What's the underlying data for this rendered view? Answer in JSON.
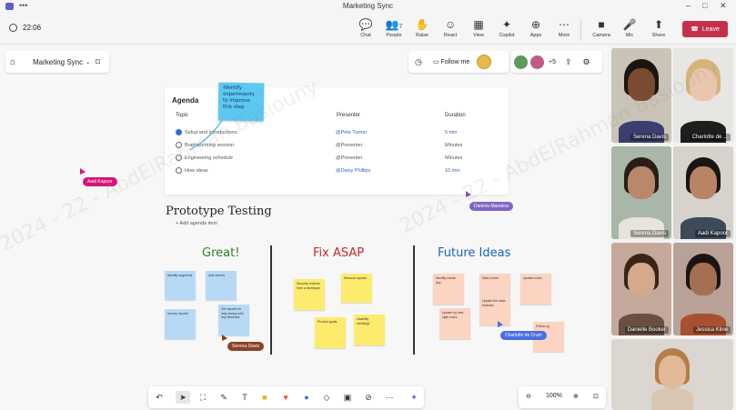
{
  "window": {
    "title": "Marketing Sync",
    "dots": "•••"
  },
  "toolbar": {
    "time": "22:06",
    "buttons": [
      {
        "label": "Chat",
        "icon": "chat-icon",
        "glyph": "💬"
      },
      {
        "label": "People",
        "icon": "people-icon",
        "glyph": "👥",
        "count": "7"
      },
      {
        "label": "Raise",
        "icon": "raise-hand-icon",
        "glyph": "✋"
      },
      {
        "label": "React",
        "icon": "react-icon",
        "glyph": "☺"
      },
      {
        "label": "View",
        "icon": "view-icon",
        "glyph": "▦"
      },
      {
        "label": "Copilot",
        "icon": "copilot-icon",
        "glyph": "✦"
      },
      {
        "label": "Apps",
        "icon": "apps-icon",
        "glyph": "⊕"
      },
      {
        "label": "More",
        "icon": "more-icon",
        "glyph": "⋯"
      },
      {
        "label": "Camera",
        "icon": "camera-icon",
        "glyph": "■"
      },
      {
        "label": "Mic",
        "icon": "mic-icon",
        "glyph": "🎤"
      },
      {
        "label": "Share",
        "icon": "share-icon",
        "glyph": "⬆"
      }
    ],
    "leave": "Leave"
  },
  "board": {
    "name": "Marketing Sync",
    "follow": "Follow me",
    "participant_extra": "+5"
  },
  "agenda": {
    "title": "Agenda",
    "headers": {
      "topic": "Topic",
      "presenter": "Presenter",
      "duration": "Duration"
    },
    "rows": [
      {
        "topic": "Setup and introductions",
        "presenter": "@Pete Turner",
        "duration": "5 min",
        "done": true
      },
      {
        "topic": "Brainstorming session",
        "presenter": "@Presenter",
        "duration": "Minutes",
        "done": false
      },
      {
        "topic": "Engineering schedule",
        "presenter": "@Presenter",
        "duration": "Minutes",
        "done": false
      },
      {
        "topic": "How ideas",
        "presenter": "@Daisy Phillips",
        "duration": "10 min",
        "done": false
      }
    ],
    "add": "+ Add agenda item"
  },
  "sticky_note": "Identify experiments to improve this step",
  "cursors": {
    "aadi": "Aadi Kapoor",
    "daniela": "Daniela Mandera",
    "serena": "Serena Davis",
    "charlotte": "Charlotte de Crum"
  },
  "section_title": "Prototype Testing",
  "columns": [
    {
      "title": "Great!",
      "color": "#2e7d32"
    },
    {
      "title": "Fix ASAP",
      "color": "#c62828"
    },
    {
      "title": "Future Ideas",
      "color": "#1565c0"
    }
  ],
  "notes": {
    "great": [
      "Identify segments",
      "Add reports",
      "Survey reports",
      "Set reports for help during with any timelines"
    ],
    "fix": [
      "Security reviews from a developer",
      "Remove reports",
      "Product goals",
      "Usability meetings"
    ],
    "future": [
      "Identify needs key",
      "Start a form",
      "Update notes",
      "Update the main features",
      "Update by new style notes",
      "Follow up"
    ]
  },
  "zoom": {
    "level": "100%"
  },
  "gallery": [
    {
      "name": "Serena Davis"
    },
    {
      "name": "Charlotte de ..."
    },
    {
      "name": "Serena Davis"
    },
    {
      "name": "Aadi Kapoor"
    },
    {
      "name": "Danielle Booker"
    },
    {
      "name": "Jessica Kline"
    },
    {
      "name": ""
    }
  ],
  "watermark": "2024 - 22 - AbdElRahman Basiouny"
}
